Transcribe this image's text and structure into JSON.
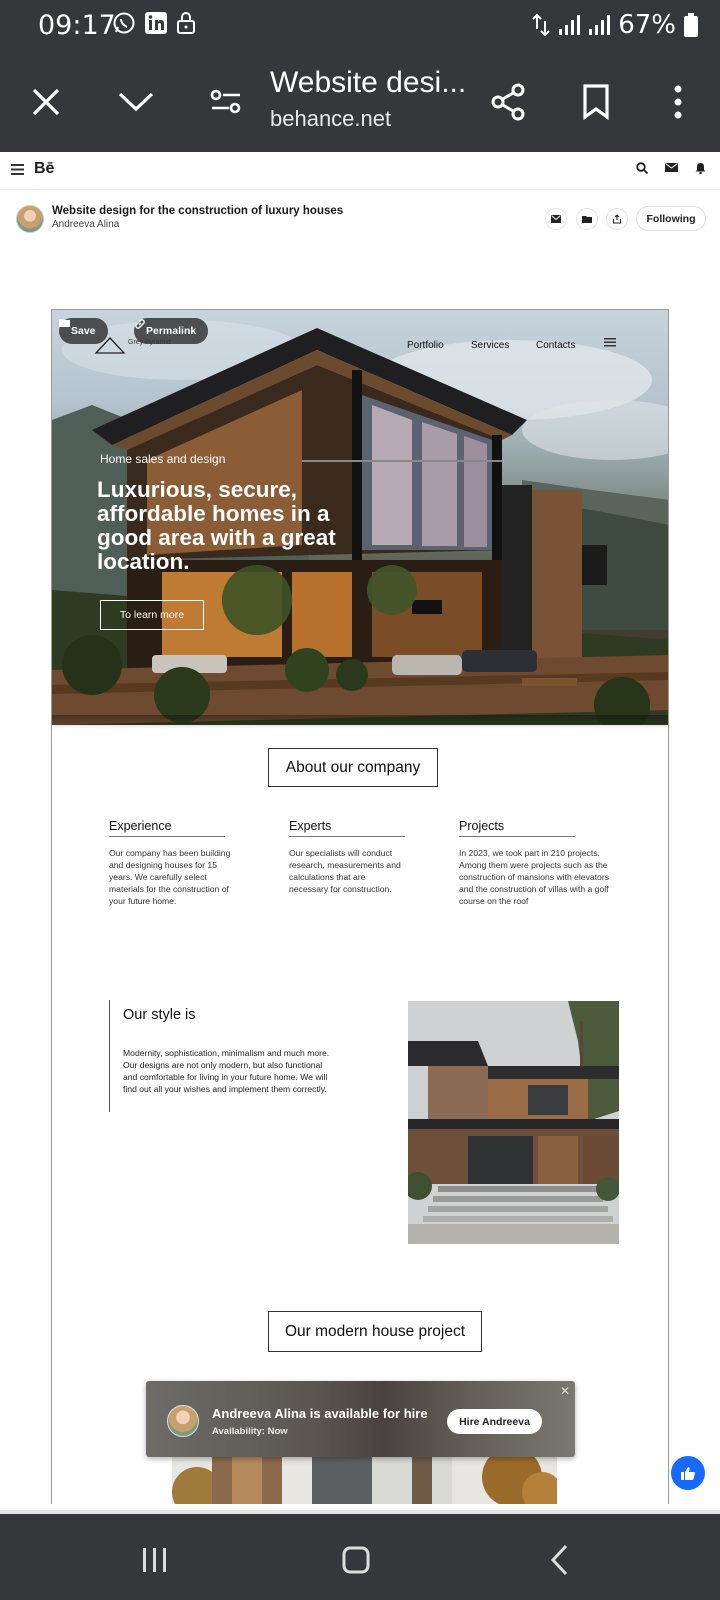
{
  "status_bar": {
    "time": "09:17",
    "battery": "67%"
  },
  "browser": {
    "title": "Website desi...",
    "url": "behance.net"
  },
  "behance": {
    "logo": "Bē"
  },
  "project": {
    "title": "Website design for the construction of luxury houses",
    "author": "Andreeva Alina",
    "following_label": "Following"
  },
  "hero": {
    "save_label": "Save",
    "permalink_label": "Permalink",
    "logo_text": "Grey Pyramid",
    "nav": [
      "Portfolio",
      "Services",
      "Contacts"
    ],
    "subtitle": "Home sales and design",
    "title": "Luxurious, secure, affordable homes in a good area with a great location.",
    "cta": "To learn more"
  },
  "about": {
    "heading": "About our company",
    "columns": [
      {
        "title": "Experience",
        "text": "Our company has been building and designing houses for 15 years. We carefully select materials for the construction of your future home."
      },
      {
        "title": "Experts",
        "text": "Our specialists will conduct research, measurements and calculations that are necessary for construction."
      },
      {
        "title": "Projects",
        "text": "In 2023, we took part in 210 projects. Among them were projects such as the construction of mansions with elevators and the construction of villas with a golf course on the roof"
      }
    ]
  },
  "style": {
    "title": "Our style is",
    "text": "Modernity, sophistication, minimalism and much more. Our designs are not only modern, but also functional and comfortable for living in your future home. We will find out all your wishes and implement them correctly."
  },
  "project_section": {
    "heading": "Our modern house project"
  },
  "hire": {
    "title": "Andreeva Alina is available for hire",
    "availability": "Availability: Now",
    "button": "Hire Andreeva"
  },
  "colors": {
    "bar_bg": "#36373b",
    "fab_blue": "#1769ff"
  }
}
